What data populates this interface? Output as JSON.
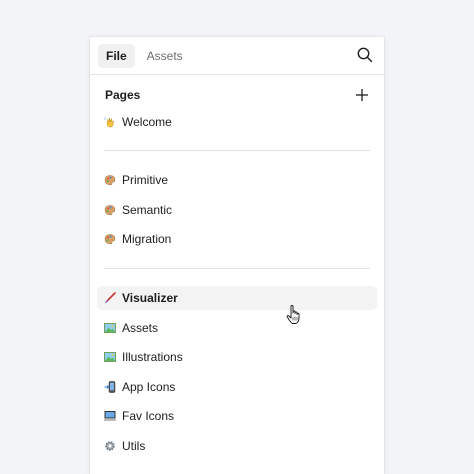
{
  "tabs": [
    {
      "label": "File",
      "active": true
    },
    {
      "label": "Assets",
      "active": false
    }
  ],
  "pages_section": {
    "title": "Pages"
  },
  "groups": [
    [
      {
        "label": "Welcome",
        "icon": "waving-hand-icon"
      }
    ],
    [
      {
        "label": "Primitive",
        "icon": "palette-icon"
      },
      {
        "label": "Semantic",
        "icon": "palette-icon"
      },
      {
        "label": "Migration",
        "icon": "palette-icon"
      }
    ],
    [
      {
        "label": "Visualizer",
        "icon": "paintbrush-icon",
        "selected": true
      },
      {
        "label": "Assets",
        "icon": "picture-icon"
      },
      {
        "label": "Illustrations",
        "icon": "picture-icon"
      },
      {
        "label": "App Icons",
        "icon": "mobile-arrow-icon"
      },
      {
        "label": "Fav Icons",
        "icon": "computer-icon"
      },
      {
        "label": "Utils",
        "icon": "gear-icon"
      }
    ]
  ],
  "colors": {
    "background": "#f2f4f7",
    "panel": "#ffffff",
    "selected_row": "#f3f3f3"
  }
}
